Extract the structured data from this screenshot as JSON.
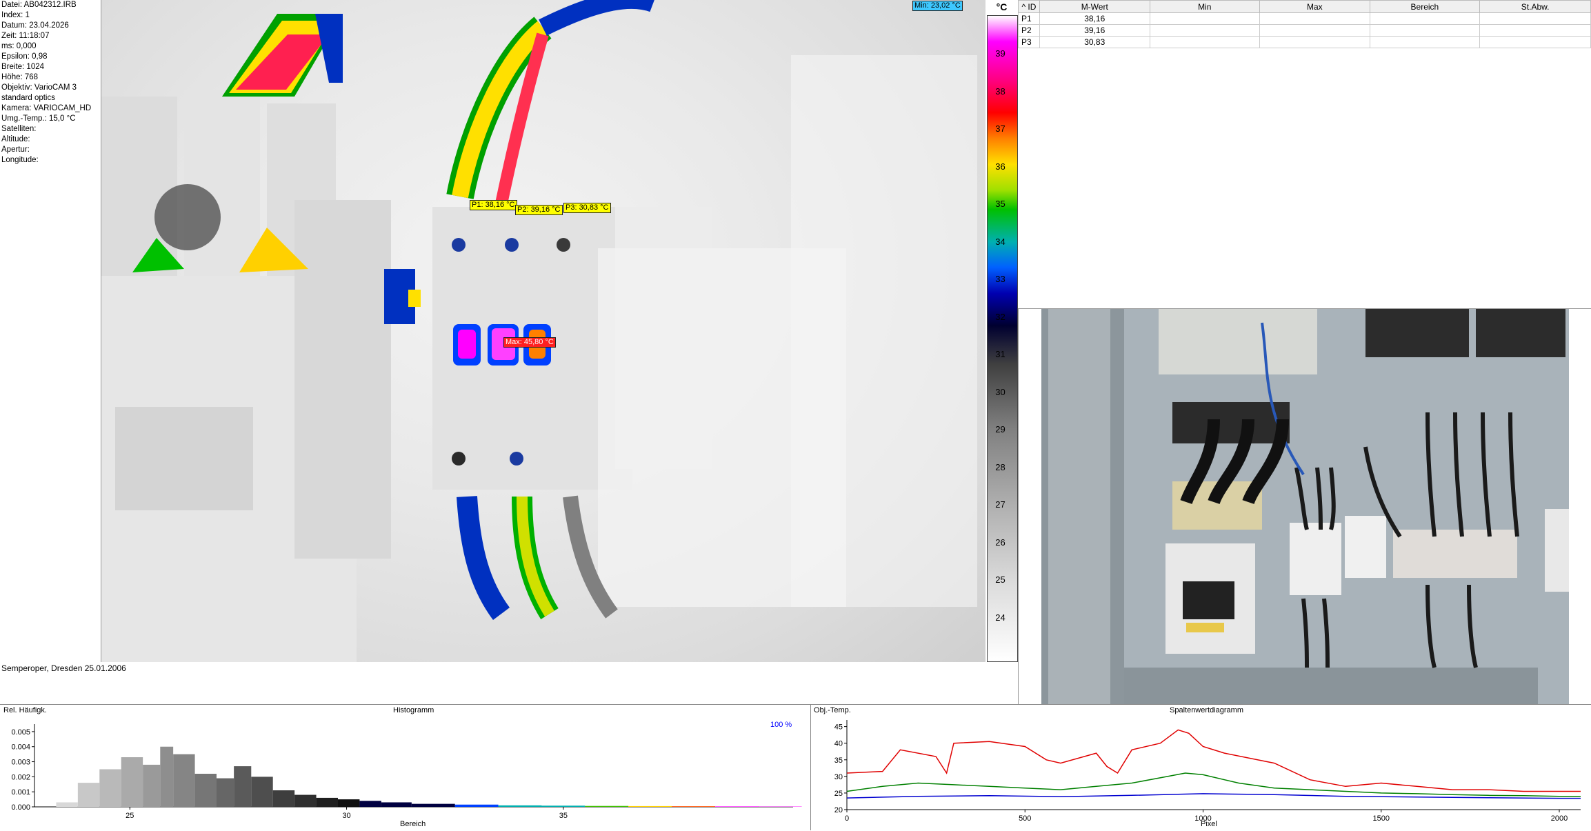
{
  "metadata": [
    {
      "label": "Datei",
      "value": "AB042312.IRB"
    },
    {
      "label": "Index",
      "value": "1"
    },
    {
      "label": "Datum",
      "value": "23.04.2026"
    },
    {
      "label": "Zeit",
      "value": "11:18:07"
    },
    {
      "label": "ms",
      "value": "0,000"
    },
    {
      "label": "Epsilon",
      "value": "0,98"
    },
    {
      "label": "Breite",
      "value": "1024"
    },
    {
      "label": "Höhe",
      "value": "768"
    },
    {
      "label": "Objektiv",
      "value": "VarioCAM 3"
    },
    {
      "label": "",
      "value": "standard optics"
    },
    {
      "label": "Kamera",
      "value": "VARIOCAM_HD"
    },
    {
      "label": "Umg.-Temp.",
      "value": "15,0 °C"
    },
    {
      "label": "Satelliten",
      "value": ""
    },
    {
      "label": "Altitude",
      "value": ""
    },
    {
      "label": "Apertur",
      "value": ""
    },
    {
      "label": "Longitude",
      "value": ""
    }
  ],
  "thermal": {
    "min_label": "Min: 23,02 °C",
    "max_label": "Max: 45,80 °C",
    "points": [
      {
        "label": "P1: 38,16 °C"
      },
      {
        "label": "P2: 39,16 °C"
      },
      {
        "label": "P3: 30,83 °C"
      }
    ]
  },
  "scale": {
    "unit": "°C",
    "ticks": [
      "39",
      "38",
      "37",
      "36",
      "35",
      "34",
      "33",
      "32",
      "31",
      "30",
      "29",
      "28",
      "27",
      "26",
      "25",
      "24"
    ]
  },
  "table": {
    "headers": [
      "ID",
      "M-Wert",
      "Min",
      "Max",
      "Bereich",
      "St.Abw."
    ],
    "rows": [
      [
        "P1",
        "38,16",
        "",
        "",
        "",
        ""
      ],
      [
        "P2",
        "39,16",
        "",
        "",
        "",
        ""
      ],
      [
        "P3",
        "30,83",
        "",
        "",
        "",
        ""
      ]
    ]
  },
  "caption": "Semperoper, Dresden 25.01.2006",
  "histogram": {
    "ylabel": "Rel. Häufigk.",
    "title": "Histogramm",
    "xlabel": "Bereich",
    "percent": "100 %"
  },
  "column_chart": {
    "ylabel": "Obj.-Temp.",
    "title": "Spaltenwertdiagramm",
    "xlabel": "Pixel"
  },
  "chart_data": [
    {
      "type": "bar",
      "title": "Histogramm",
      "xlabel": "Bereich",
      "ylabel": "Rel. Häufigk.",
      "xlim": [
        22.8,
        40.3
      ],
      "ylim": [
        0,
        0.0055
      ],
      "xticks": [
        25,
        30,
        35
      ],
      "yticks": [
        "0.000",
        "0.001",
        "0.002",
        "0.003",
        "0.004",
        "0.005"
      ],
      "x": [
        23.3,
        23.8,
        24.3,
        24.8,
        25.3,
        25.7,
        26.0,
        26.5,
        27.0,
        27.4,
        27.8,
        28.3,
        28.8,
        29.3,
        29.8,
        30.3,
        30.8,
        31.5,
        32.5,
        33.5,
        34.5,
        35.5,
        36.5,
        37.5,
        38.5,
        39.5
      ],
      "values": [
        0.0003,
        0.0016,
        0.0025,
        0.0033,
        0.0028,
        0.004,
        0.0035,
        0.0022,
        0.0019,
        0.0027,
        0.002,
        0.0011,
        0.0008,
        0.0006,
        0.0005,
        0.0004,
        0.0003,
        0.0002,
        0.00015,
        0.0001,
        8e-05,
        6e-05,
        5e-05,
        4e-05,
        3e-05,
        2e-05
      ]
    },
    {
      "type": "line",
      "title": "Spaltenwertdiagramm",
      "xlabel": "Pixel",
      "ylabel": "Obj.-Temp.",
      "xlim": [
        0,
        2060
      ],
      "ylim": [
        20,
        47
      ],
      "xticks": [
        0,
        500,
        1000,
        1500,
        2000
      ],
      "yticks": [
        20,
        25,
        30,
        35,
        40,
        45
      ],
      "series": [
        {
          "color": "#e00000",
          "x": [
            0,
            100,
            150,
            250,
            280,
            300,
            400,
            500,
            560,
            600,
            700,
            730,
            760,
            800,
            880,
            930,
            960,
            1000,
            1060,
            1200,
            1300,
            1400,
            1500,
            1600,
            1700,
            1800,
            1900,
            2000,
            2060
          ],
          "y": [
            31,
            31.5,
            38,
            36,
            31,
            40,
            40.5,
            39,
            35,
            34,
            37,
            33,
            31,
            38,
            40,
            44,
            43,
            39,
            37,
            34,
            29,
            27,
            28,
            27,
            26,
            26,
            25.5,
            25.5,
            25.5
          ]
        },
        {
          "color": "#008000",
          "x": [
            0,
            100,
            200,
            300,
            400,
            500,
            600,
            700,
            800,
            900,
            950,
            1000,
            1100,
            1200,
            1300,
            1400,
            1500,
            1600,
            1700,
            1800,
            1900,
            2000,
            2060
          ],
          "y": [
            25.5,
            27,
            28,
            27.5,
            27,
            26.5,
            26,
            27,
            28,
            30,
            31,
            30.5,
            28,
            26.5,
            26,
            25.5,
            25,
            24.8,
            24.5,
            24.3,
            24.2,
            24,
            24
          ]
        },
        {
          "color": "#0000d0",
          "x": [
            0,
            200,
            400,
            600,
            800,
            1000,
            1200,
            1400,
            1600,
            1800,
            2000,
            2060
          ],
          "y": [
            23.5,
            24,
            24.2,
            23.9,
            24.3,
            24.8,
            24.5,
            24,
            23.8,
            23.6,
            23.4,
            23.4
          ]
        }
      ]
    }
  ]
}
